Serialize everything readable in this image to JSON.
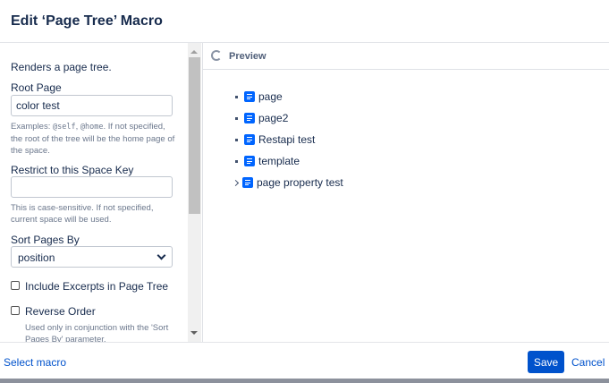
{
  "dialog": {
    "title": "Edit ‘Page Tree’ Macro"
  },
  "form": {
    "description": "Renders a page tree.",
    "root_page": {
      "label": "Root Page",
      "value": "color test",
      "help_prefix": "Examples: ",
      "code1": "@self",
      "sep": ", ",
      "code2": "@home",
      "help_suffix": ". If not specified, the root of the tree will be the home page of the space."
    },
    "space_key": {
      "label": "Restrict to this Space Key",
      "value": "",
      "help": "This is case-sensitive. If not specified, current space will be used."
    },
    "sort": {
      "label": "Sort Pages By",
      "value": "position"
    },
    "excerpts": {
      "label": "Include Excerpts in Page Tree",
      "checked": false
    },
    "reverse": {
      "label": "Reverse Order",
      "checked": false,
      "help": "Used only in conjunction with the 'Sort Pages By' parameter."
    }
  },
  "preview": {
    "title": "Preview",
    "items": [
      {
        "label": "page",
        "expandable": false
      },
      {
        "label": "page2",
        "expandable": false
      },
      {
        "label": "Restapi test",
        "expandable": false
      },
      {
        "label": "template",
        "expandable": false
      },
      {
        "label": "page property test",
        "expandable": true
      }
    ]
  },
  "footer": {
    "select_macro": "Select macro",
    "save": "Save",
    "cancel": "Cancel"
  }
}
